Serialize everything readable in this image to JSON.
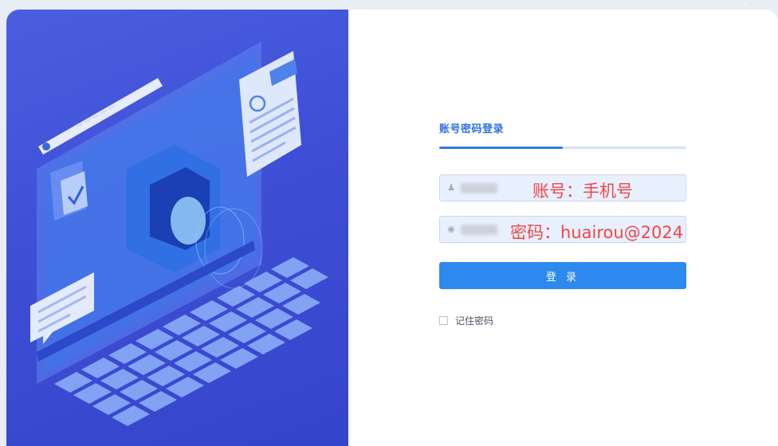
{
  "login": {
    "tab_label": "账号密码登录",
    "username": {
      "icon": "user-icon",
      "placeholder": "",
      "annotation": "账号：手机号"
    },
    "password": {
      "icon": "lock-icon",
      "placeholder": "",
      "annotation": "密码：huairou@2024"
    },
    "submit_label": "登 录",
    "remember_label": "记住密码"
  },
  "colors": {
    "hero_bg": "#3e4fd6",
    "accent": "#2d89ee",
    "annotation": "#f04646"
  }
}
